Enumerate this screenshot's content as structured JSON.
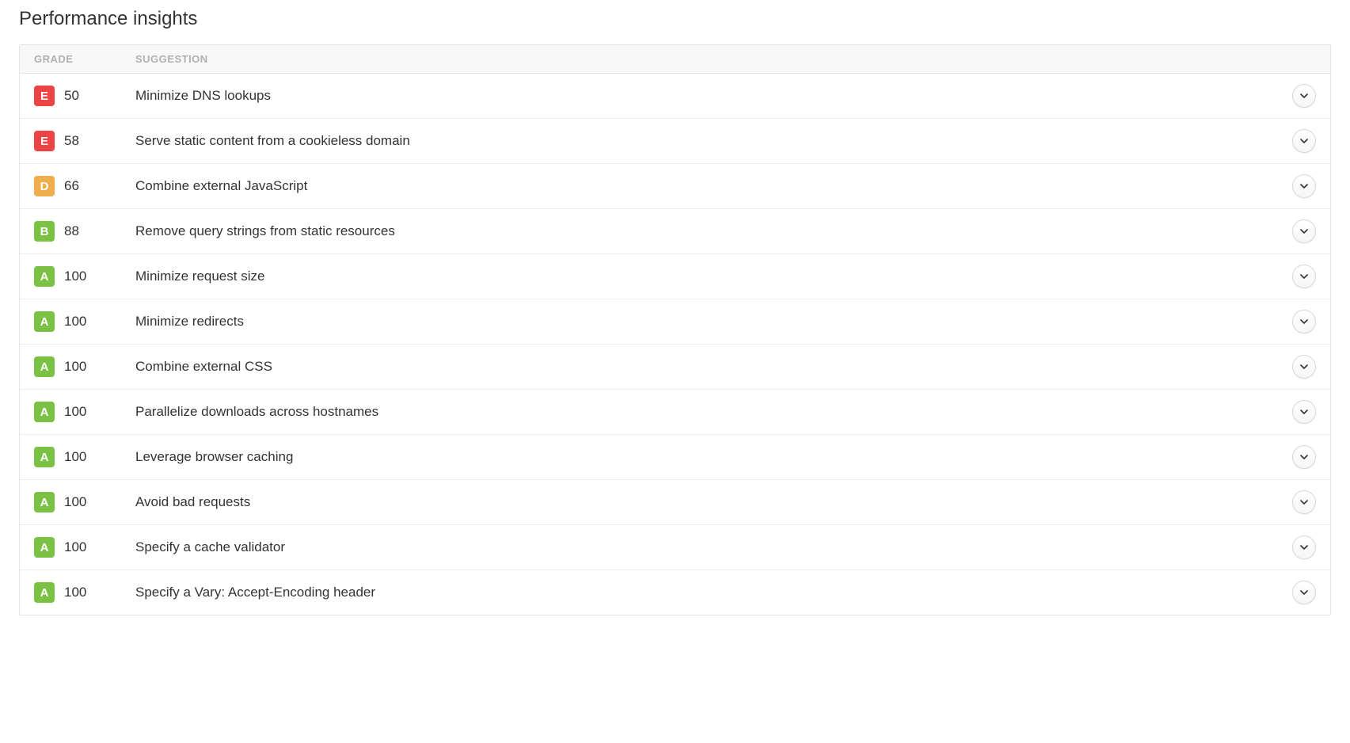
{
  "title": "Performance insights",
  "headers": {
    "grade": "GRADE",
    "suggestion": "SUGGESTION"
  },
  "rows": [
    {
      "grade": "E",
      "score": "50",
      "suggestion": "Minimize DNS lookups"
    },
    {
      "grade": "E",
      "score": "58",
      "suggestion": "Serve static content from a cookieless domain"
    },
    {
      "grade": "D",
      "score": "66",
      "suggestion": "Combine external JavaScript"
    },
    {
      "grade": "B",
      "score": "88",
      "suggestion": "Remove query strings from static resources"
    },
    {
      "grade": "A",
      "score": "100",
      "suggestion": "Minimize request size"
    },
    {
      "grade": "A",
      "score": "100",
      "suggestion": "Minimize redirects"
    },
    {
      "grade": "A",
      "score": "100",
      "suggestion": "Combine external CSS"
    },
    {
      "grade": "A",
      "score": "100",
      "suggestion": "Parallelize downloads across hostnames"
    },
    {
      "grade": "A",
      "score": "100",
      "suggestion": "Leverage browser caching"
    },
    {
      "grade": "A",
      "score": "100",
      "suggestion": "Avoid bad requests"
    },
    {
      "grade": "A",
      "score": "100",
      "suggestion": "Specify a cache validator"
    },
    {
      "grade": "A",
      "score": "100",
      "suggestion": "Specify a Vary: Accept-Encoding header"
    }
  ]
}
